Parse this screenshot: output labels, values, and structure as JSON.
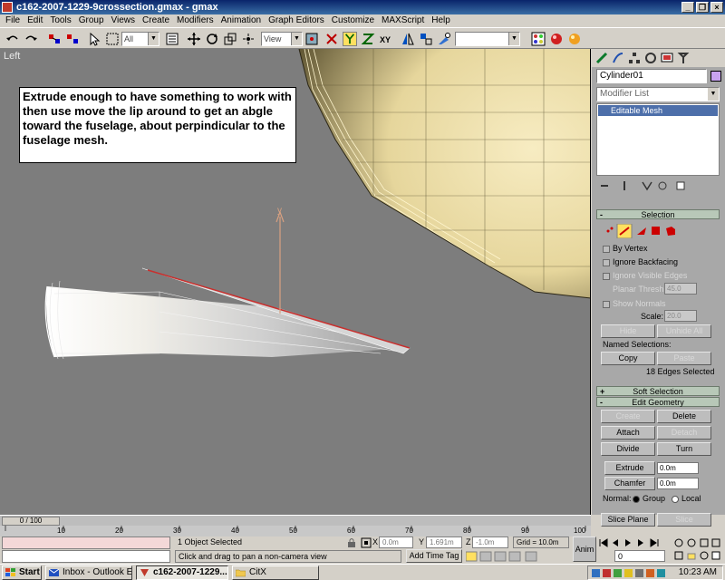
{
  "window": {
    "title": "c162-2007-1229-9crossection.gmax - gmax"
  },
  "menu": [
    "File",
    "Edit",
    "Tools",
    "Group",
    "Views",
    "Create",
    "Modifiers",
    "Animation",
    "Graph Editors",
    "Customize",
    "MAXScript",
    "Help"
  ],
  "toolbar": {
    "selection_filter": "All",
    "reference_coord": "View",
    "named_selection": ""
  },
  "viewport": {
    "label": "Left",
    "note": "Extrude enough to have something to work with then use move the lip around to get an abgle toward the fuselage, about perpindicular to the fuselage mesh.",
    "gizmo_axis_label": "y"
  },
  "command_panel": {
    "object_name": "Cylinder01",
    "object_color": "#c8a3f0",
    "modifier_list_label": "Modifier List",
    "stack_item": "Editable Mesh",
    "selection": {
      "title": "Selection",
      "by_vertex": "By Vertex",
      "ignore_backfacing": "Ignore Backfacing",
      "ignore_visible_edges": "Ignore Visible Edges",
      "planar_thresh_label": "Planar Thresh:",
      "planar_thresh_value": "45.0",
      "show_normals": "Show Normals",
      "scale_label": "Scale:",
      "scale_value": "20.0",
      "hide": "Hide",
      "unhide_all": "Unhide All",
      "named_selections": "Named Selections:",
      "copy": "Copy",
      "paste": "Paste",
      "status": "18 Edges Selected"
    },
    "soft_selection": {
      "title": "Soft Selection"
    },
    "edit_geometry": {
      "title": "Edit Geometry",
      "create": "Create",
      "delete": "Delete",
      "attach": "Attach",
      "detach": "Detach",
      "divide": "Divide",
      "turn": "Turn",
      "extrude": "Extrude",
      "extrude_value": "0.0m",
      "chamfer": "Chamfer",
      "chamfer_value": "0.0m",
      "normal_label": "Normal:",
      "group": "Group",
      "local": "Local",
      "slice_plane": "Slice Plane",
      "slice": "Slice"
    }
  },
  "timeline": {
    "frame_display": "0 / 100",
    "ticks": [
      "10",
      "20",
      "30",
      "40",
      "50",
      "60",
      "70",
      "80",
      "90",
      "100"
    ]
  },
  "status": {
    "selected": "1 Object Selected",
    "prompt": "Click and drag to pan a non-camera view",
    "x_label": "X",
    "x_value": "0.0m",
    "y_label": "Y",
    "y_value": "1.691m",
    "z_label": "Z",
    "z_value": "-1.0m",
    "grid": "Grid = 10.0m",
    "add_time_tag": "Add Time Tag",
    "anim": "Anim",
    "frame_field": "0"
  },
  "taskbar": {
    "start": "Start",
    "tasks": [
      "Inbox - Outlook E...",
      "c162-2007-1229...",
      "CitX"
    ],
    "time": "10:23 AM"
  },
  "colors": {
    "viewport_bg": "#7d7d7d",
    "fuselage": "#e8d9a2",
    "selected_edge": "#c8302e",
    "titlebar": "#0a246a"
  }
}
